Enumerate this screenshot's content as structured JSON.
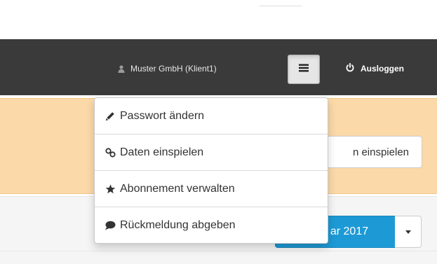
{
  "navbar": {
    "user_label": "Muster GmbH (Klient1)",
    "user_icon": "user-icon",
    "menu_icon": "hamburger-icon",
    "logout_label": "Ausloggen",
    "logout_icon": "power-icon",
    "background": "#3a3a3a"
  },
  "alert": {
    "import_button_label": "n einspielen",
    "background": "#fcd9a8"
  },
  "period": {
    "selected_label": "ar 2017",
    "accent": "#1d9ad6"
  },
  "dropdown": {
    "items": [
      {
        "label": "Passwort ändern",
        "icon": "pencil-icon"
      },
      {
        "label": "Daten einspielen",
        "icon": "link-icon"
      },
      {
        "label": "Abonnement verwalten",
        "icon": "star-icon"
      },
      {
        "label": "Rückmeldung abgeben",
        "icon": "comment-icon"
      }
    ]
  }
}
